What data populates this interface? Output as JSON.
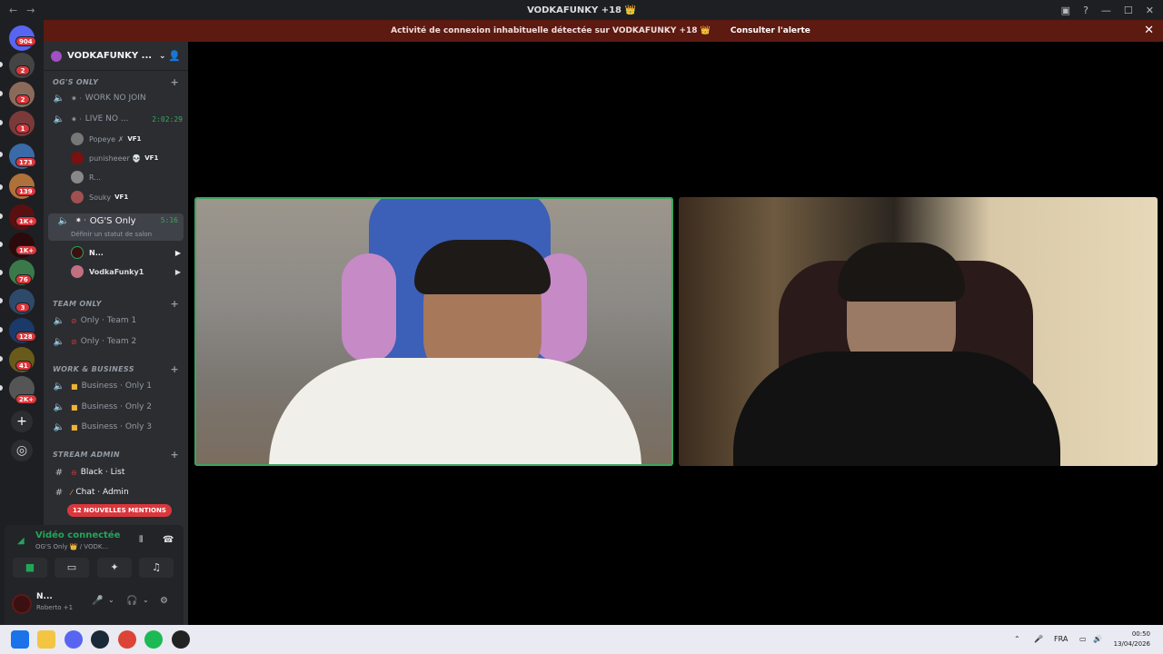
{
  "window": {
    "title": "VODKAFUNKY +18 👑"
  },
  "alert": {
    "text": "Activité de connexion inhabituelle détectée sur VODKAFUNKY +18 👑",
    "cta": "Consulter l'alerte"
  },
  "servers": {
    "badges": [
      "904",
      "2",
      "2",
      "1",
      "173",
      "139",
      "1K+",
      "1K+",
      "76",
      "3",
      "128",
      "41",
      "2K+"
    ]
  },
  "guild": {
    "name": "VODKAFUNKY ..."
  },
  "categories": {
    "og": "OG'S ONLY",
    "team": "TEAM ONLY",
    "work": "WORK & BUSINESS",
    "stream": "STREAM ADMIN"
  },
  "channels": {
    "work_no_join": "WORK NO JOIN",
    "live_no": "LIVE NO ...",
    "live_timer": "2:02:29",
    "ogs_only": "OG'S Only",
    "ogs_timer": "5:16",
    "ogs_status": "Définir un statut de salon",
    "team1": "Only · Team 1",
    "team2": "Only · Team 2",
    "biz1": "Business · Only 1",
    "biz2": "Business · Only 2",
    "biz3": "Business · Only 3",
    "black_list": "Black · List",
    "chat_admin": "Chat · Admin"
  },
  "voice_users": {
    "popeye": "Popeye ✗",
    "punisheeer": "punisheeer 💀",
    "r": "R...",
    "souky": "Souky",
    "n": "N...",
    "vodkafunky1": "VodkaFunky1",
    "tag_vf1": "VF1"
  },
  "mentions": "12 NOUVELLES MENTIONS",
  "voice": {
    "status": "Vidéo connectée",
    "location": "OG'S Only 👑 / VODK..."
  },
  "user": {
    "name": "N...",
    "activity": "Roberto +1"
  },
  "taskbar": {
    "lang": "FRA",
    "time": "00:50",
    "date": "13/04/2026"
  }
}
